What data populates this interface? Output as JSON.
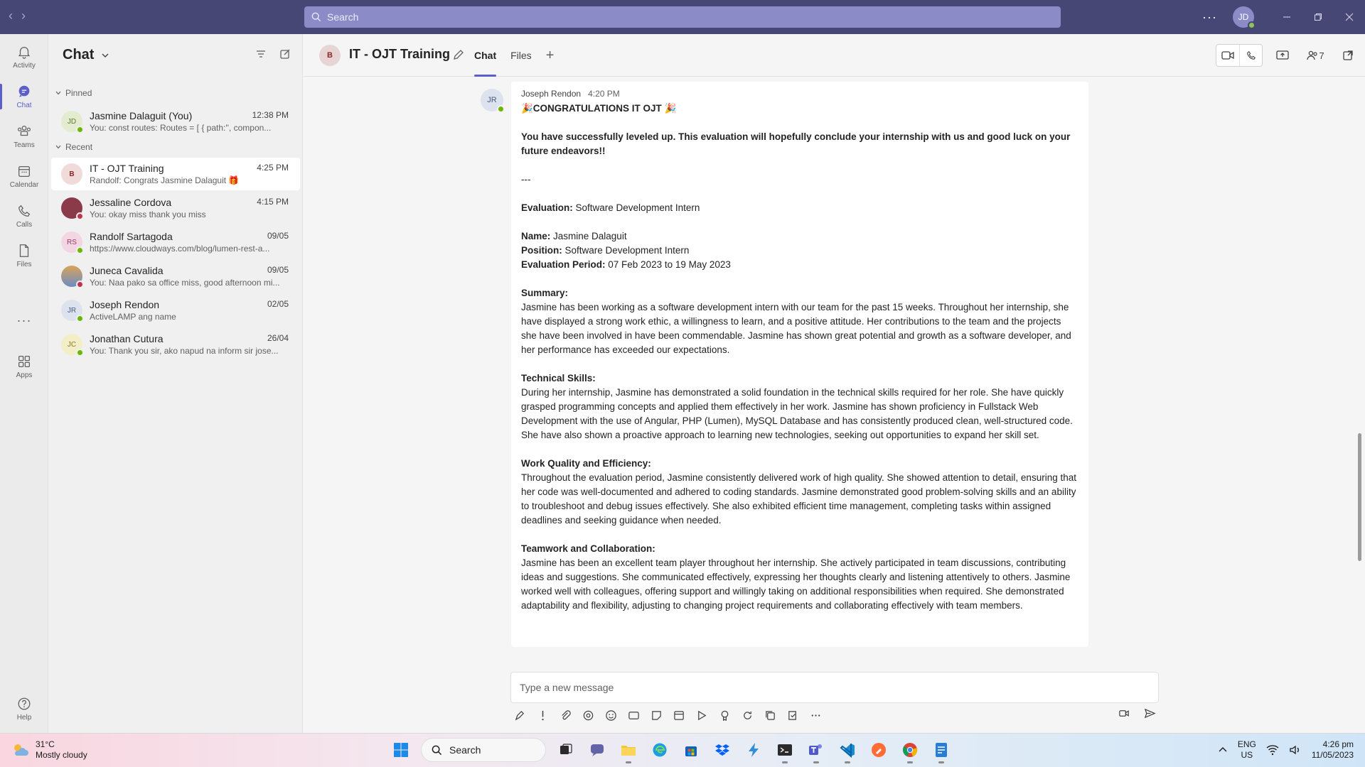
{
  "titlebar": {
    "search_placeholder": "Search",
    "user_initials": "JD",
    "more": "···"
  },
  "rail": {
    "items": [
      {
        "label": "Activity",
        "icon": "bell-icon"
      },
      {
        "label": "Chat",
        "icon": "chat-icon"
      },
      {
        "label": "Teams",
        "icon": "teams-icon"
      },
      {
        "label": "Calendar",
        "icon": "calendar-icon"
      },
      {
        "label": "Calls",
        "icon": "phone-icon"
      },
      {
        "label": "Files",
        "icon": "file-icon"
      },
      {
        "label": "Apps",
        "icon": "apps-icon"
      },
      {
        "label": "Help",
        "icon": "help-icon"
      }
    ],
    "more": "···"
  },
  "chatlist": {
    "title": "Chat",
    "pinned_label": "Pinned",
    "recent_label": "Recent",
    "pinned": [
      {
        "initials": "JD",
        "name": "Jasmine Dalaguit (You)",
        "time": "12:38 PM",
        "preview": "You: const routes: Routes = [ { path:'', compon...",
        "avatar_color": "#e3ecd0",
        "status": "green"
      }
    ],
    "recent": [
      {
        "initials": "B",
        "name": "IT - OJT Training",
        "time": "4:25 PM",
        "preview": "Randolf: Congrats Jasmine Dalaguit 🎁",
        "avatar_color": "#f0dada",
        "status": ""
      },
      {
        "initials": "",
        "name": "Jessaline Cordova",
        "time": "4:15 PM",
        "preview": "You: okay miss thank you miss",
        "avatar_color": "#8b3a4a",
        "status": "red"
      },
      {
        "initials": "RS",
        "name": "Randolf Sartagoda",
        "time": "09/05",
        "preview": "https://www.cloudways.com/blog/lumen-rest-a...",
        "avatar_color": "#f2d6e2",
        "status": "green"
      },
      {
        "initials": "",
        "name": "Juneca Cavalida",
        "time": "09/05",
        "preview": "You: Naa pako sa office miss, good afternoon mi...",
        "avatar_color": "#d9a35a",
        "status": "red"
      },
      {
        "initials": "JR",
        "name": "Joseph Rendon",
        "time": "02/05",
        "preview": "ActiveLAMP ang name",
        "avatar_color": "#dde3ee",
        "status": "green"
      },
      {
        "initials": "JC",
        "name": "Jonathan Cutura",
        "time": "26/04",
        "preview": "You: Thank you sir, ako napud na inform sir jose...",
        "avatar_color": "#f3edc8",
        "status": "green"
      }
    ]
  },
  "conversation": {
    "group_initial": "B",
    "group_name": "IT - OJT Training",
    "tabs": [
      "Chat",
      "Files"
    ],
    "participants_count": "7",
    "message": {
      "sender_initials": "JR",
      "sender": "Joseph Rendon",
      "time": "4:20 PM",
      "headline": "🎉CONGRATULATIONS IT OJT 🎉",
      "intro": "You have successfully leveled up. This evaluation will hopefully conclude your internship with us and good luck on your future endeavors!!",
      "separator": "---",
      "eval_label": "Evaluation:",
      "eval_value": " Software Development Intern",
      "name_label": "Name:",
      "name_value": " Jasmine Dalaguit",
      "position_label": "Position:",
      "position_value": " Software Development Intern",
      "period_label": "Evaluation Period:",
      "period_value": " 07 Feb 2023 to 19 May 2023",
      "summary_h": "Summary:",
      "summary": "Jasmine has been working as a software development intern with our team for the past 15 weeks. Throughout her internship, she have displayed a strong work ethic, a willingness to learn, and a positive attitude. Her contributions to the team and the projects she have been involved in have been commendable. Jasmine has shown great potential and growth as a software developer, and her performance has exceeded our expectations.",
      "tech_h": "Technical Skills:",
      "tech": "During her internship, Jasmine has demonstrated a solid foundation in the technical skills required for her role. She have quickly grasped programming concepts and applied them effectively in her work. Jasmine has shown proficiency in Fullstack Web Development with the use of Angular, PHP (Lumen), MySQL Database and has consistently produced clean, well-structured code. She have also shown a proactive approach to learning new technologies, seeking out opportunities to expand her skill set.",
      "quality_h": "Work Quality and Efficiency:",
      "quality": "Throughout the evaluation period, Jasmine consistently delivered work of high quality. She showed attention to detail, ensuring that her code was well-documented and adhered to coding standards. Jasmine demonstrated good problem-solving skills and an ability to troubleshoot and debug issues effectively. She also exhibited efficient time management, completing tasks within assigned deadlines and seeking guidance when needed.",
      "team_h": "Teamwork and Collaboration:",
      "team": "Jasmine has been an excellent team player throughout her internship. She actively participated in team discussions, contributing ideas and suggestions. She communicated effectively, expressing her thoughts clearly and listening attentively to others. Jasmine worked well with colleagues, offering support and willingly taking on additional responsibilities when required. She demonstrated adaptability and flexibility, adjusting to changing project requirements and collaborating effectively with team members."
    },
    "compose_placeholder": "Type a new message"
  },
  "taskbar": {
    "temp": "31°C",
    "condition": "Mostly cloudy",
    "search_label": "Search",
    "lang1": "ENG",
    "lang2": "US",
    "time": "4:26 pm",
    "date": "11/05/2023"
  },
  "colors": {
    "titlebar": "#464775",
    "accent": "#5b5fc7",
    "presence_available": "#6bb700",
    "presence_busy": "#c4314b"
  }
}
